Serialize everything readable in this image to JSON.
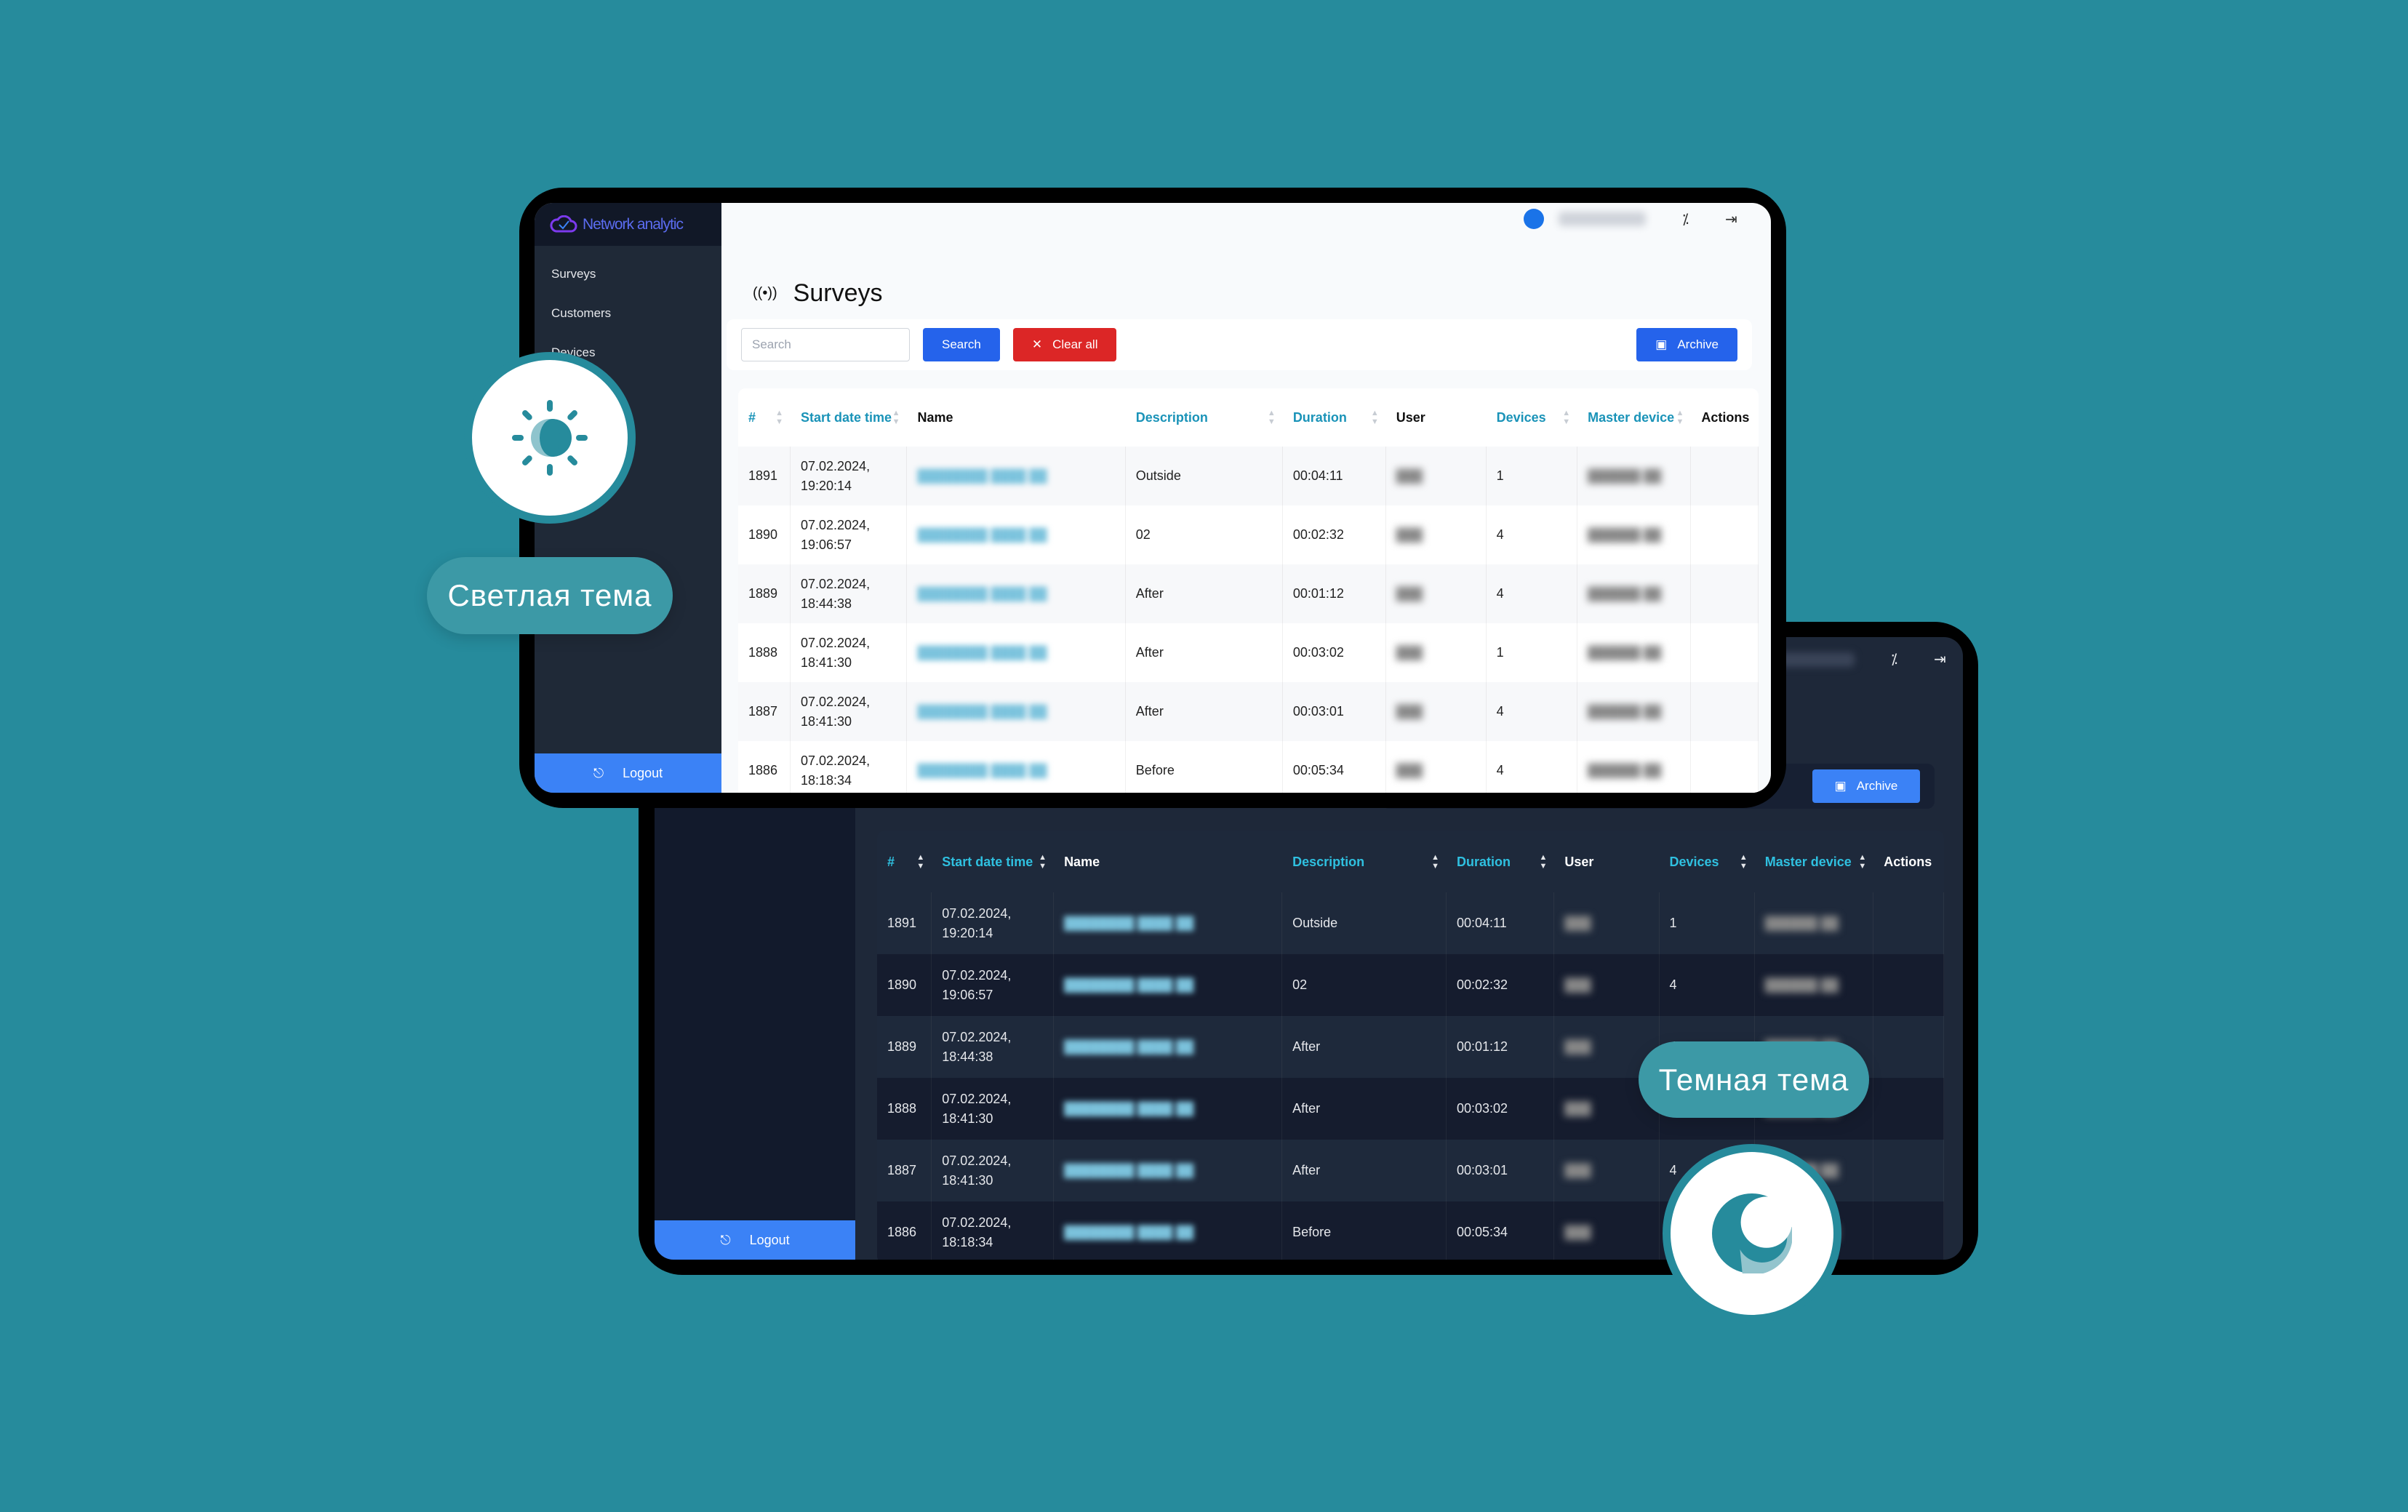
{
  "light_theme": {
    "badge_label": "Светлая тема",
    "icon": "sun-icon",
    "app_name": "Network analytic",
    "sidebar": {
      "items": [
        {
          "label": "Surveys"
        },
        {
          "label": "Customers"
        },
        {
          "label": "Devices"
        }
      ],
      "logout": "Logout"
    },
    "page_title": "Surveys",
    "search_placeholder": "Search",
    "search_button": "Search",
    "clear_button": "Clear all",
    "archive_button": "Archive"
  },
  "dark_theme": {
    "badge_label": "Темная тема",
    "icon": "moon-icon",
    "sidebar": {
      "logout": "Logout"
    },
    "archive_button": "Archive"
  },
  "table": {
    "headers": [
      "#",
      "Start date time",
      "Name",
      "Description",
      "Duration",
      "User",
      "Devices",
      "Master device",
      "Actions"
    ],
    "sortable": [
      true,
      true,
      false,
      true,
      true,
      false,
      true,
      true,
      false
    ],
    "rows": [
      {
        "id": "1891",
        "date": "07.02.2024,",
        "time": "19:20:14",
        "description": "Outside",
        "duration": "00:04:11",
        "devices": "1"
      },
      {
        "id": "1890",
        "date": "07.02.2024,",
        "time": "19:06:57",
        "description": "02",
        "duration": "00:02:32",
        "devices": "4"
      },
      {
        "id": "1889",
        "date": "07.02.2024,",
        "time": "18:44:38",
        "description": "After",
        "duration": "00:01:12",
        "devices": "4"
      },
      {
        "id": "1888",
        "date": "07.02.2024,",
        "time": "18:41:30",
        "description": "After",
        "duration": "00:03:02",
        "devices": "1"
      },
      {
        "id": "1887",
        "date": "07.02.2024,",
        "time": "18:41:30",
        "description": "After",
        "duration": "00:03:01",
        "devices": "4"
      },
      {
        "id": "1886",
        "date": "07.02.2024,",
        "time": "18:18:34",
        "description": "Before",
        "duration": "00:05:34",
        "devices": "4"
      }
    ]
  },
  "colors": {
    "background": "#268b9c",
    "primary": "#2563eb",
    "danger": "#dc2626",
    "header_accent_light": "#1a93b8",
    "header_accent_dark": "#2fc0e0",
    "dark_bg": "#1e2839"
  }
}
